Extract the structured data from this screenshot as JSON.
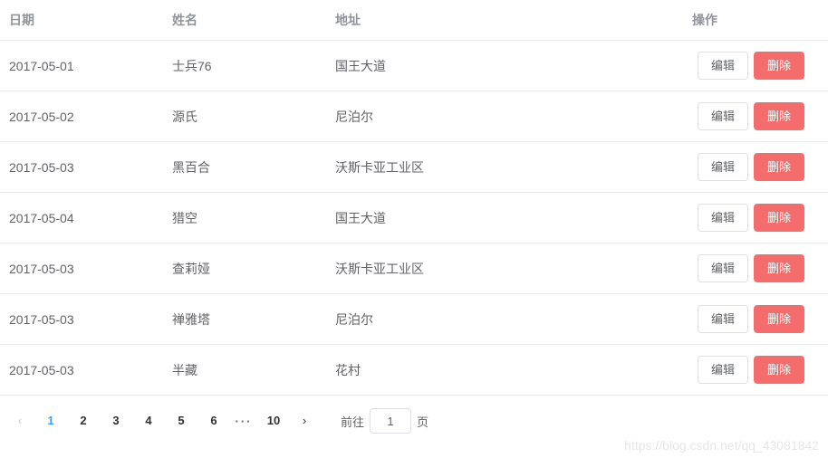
{
  "table": {
    "headers": {
      "date": "日期",
      "name": "姓名",
      "address": "地址",
      "ops": "操作"
    },
    "editLabel": "编辑",
    "deleteLabel": "删除",
    "rows": [
      {
        "date": "2017-05-01",
        "name": "士兵76",
        "address": "国王大道"
      },
      {
        "date": "2017-05-02",
        "name": "源氏",
        "address": "尼泊尔"
      },
      {
        "date": "2017-05-03",
        "name": "黑百合",
        "address": "沃斯卡亚工业区"
      },
      {
        "date": "2017-05-04",
        "name": "猎空",
        "address": "国王大道"
      },
      {
        "date": "2017-05-03",
        "name": "查莉娅",
        "address": "沃斯卡亚工业区"
      },
      {
        "date": "2017-05-03",
        "name": "禅雅塔",
        "address": "尼泊尔"
      },
      {
        "date": "2017-05-03",
        "name": "半藏",
        "address": "花村"
      }
    ]
  },
  "pagination": {
    "prev": "‹",
    "next": "›",
    "pages": [
      "1",
      "2",
      "3",
      "4",
      "5",
      "6"
    ],
    "ellipsis": "···",
    "last": "10",
    "current": "1",
    "jumpPrefix": "前往",
    "jumpSuffix": "页",
    "jumpValue": "1"
  },
  "watermark": "https://blog.csdn.net/qq_43081842"
}
